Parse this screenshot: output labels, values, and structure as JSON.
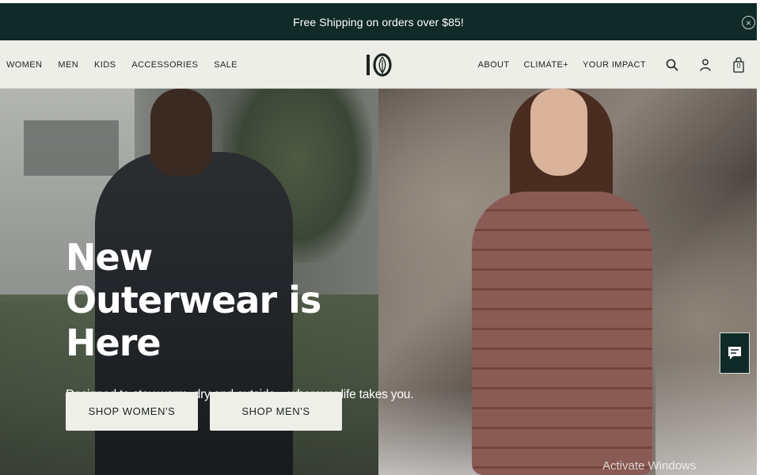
{
  "announcement": {
    "text": "Free Shipping on orders over $85!",
    "close_icon": "close-circle-icon"
  },
  "nav": {
    "left_items": [
      "WOMEN",
      "MEN",
      "KIDS",
      "ACCESSORIES",
      "SALE"
    ],
    "logo_text": "10",
    "right_items": [
      "ABOUT",
      "CLIMATE+",
      "YOUR IMPACT"
    ],
    "icons": [
      "search-icon",
      "account-icon",
      "cart-icon"
    ],
    "cart_count": "0"
  },
  "hero": {
    "title": "New Outerwear is Here",
    "subtitle": "Designed to stay warm, dry and outside – wherever life takes you.",
    "buttons": {
      "women": "SHOP WOMEN'S",
      "men": "SHOP MEN'S"
    }
  },
  "overlay": {
    "watermark": "Activate Windows",
    "chat_icon": "chat-icon"
  },
  "colors": {
    "announcement_bg": "#0f2a27",
    "nav_bg": "#edeee8",
    "button_bg": "#efefe9"
  }
}
